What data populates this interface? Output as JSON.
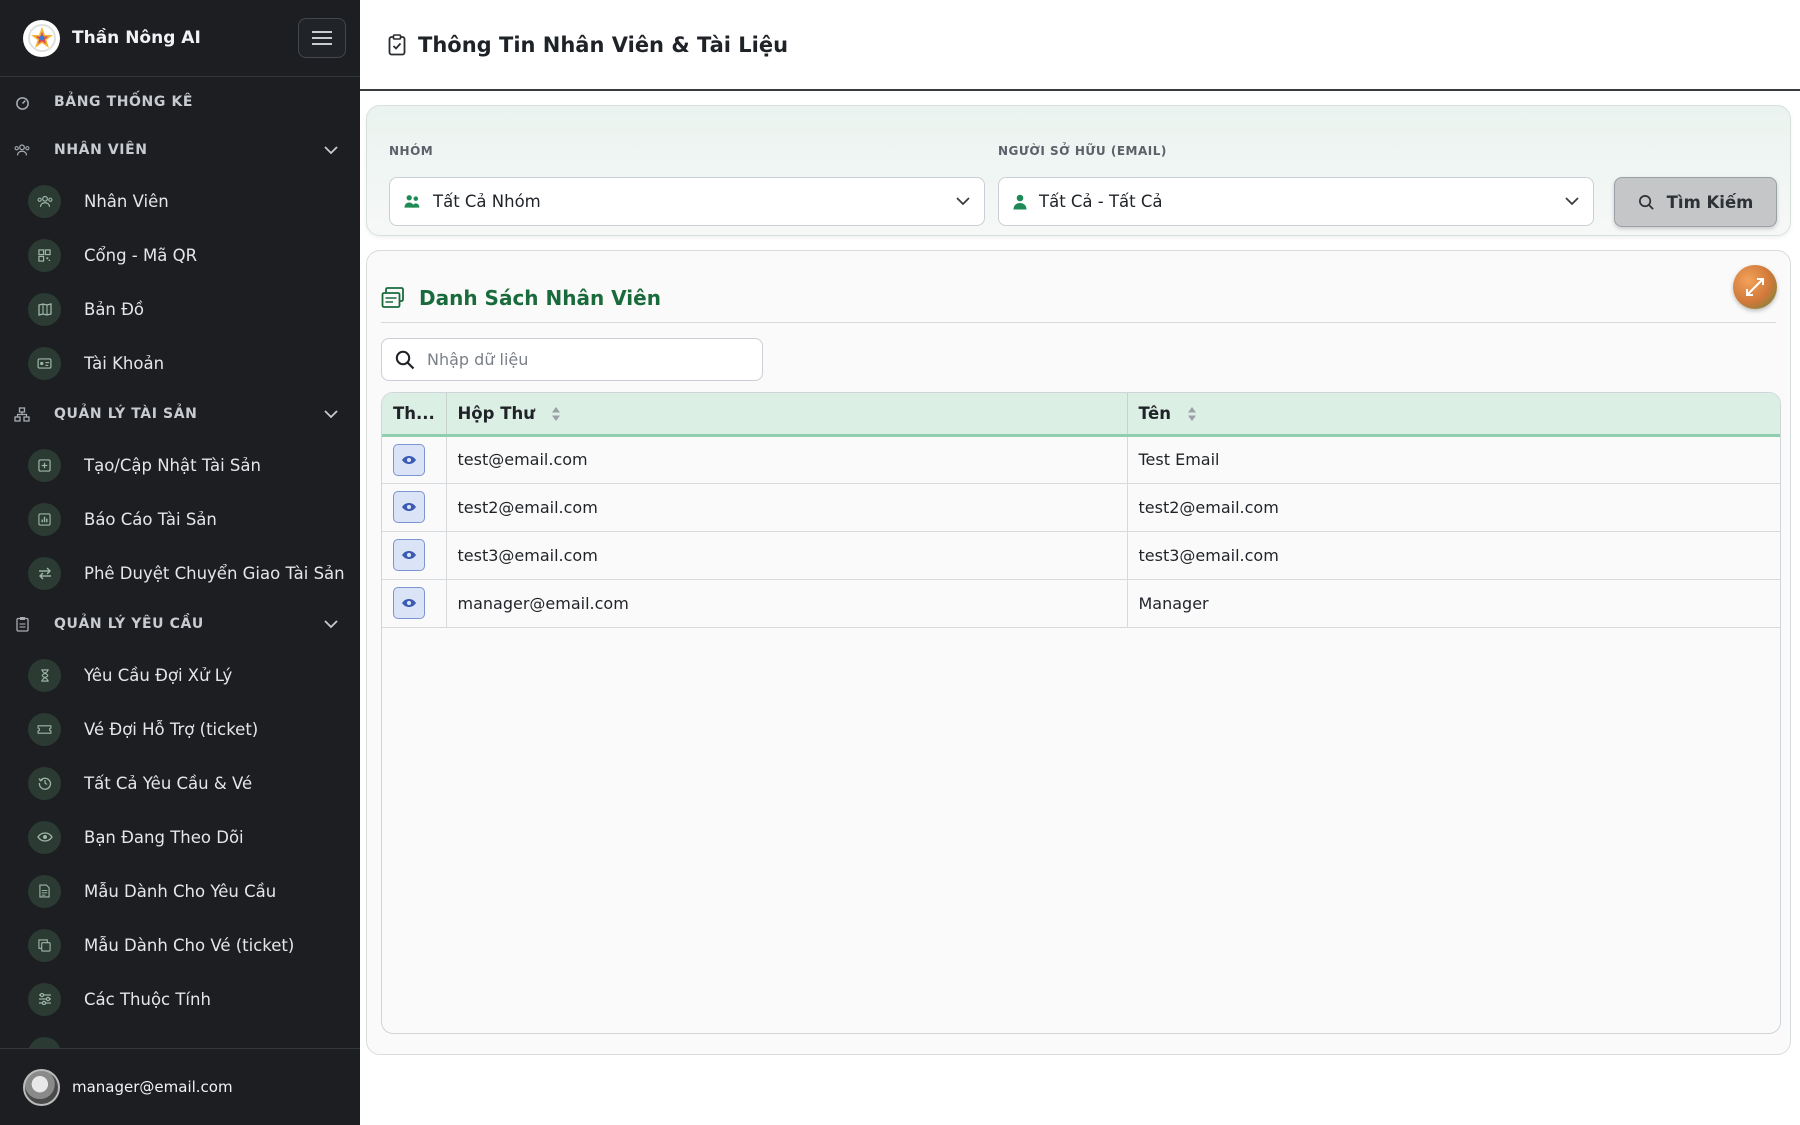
{
  "app": {
    "name": "Thần Nông AI"
  },
  "sidebar": {
    "sections": [
      {
        "label": "BẢNG THỐNG KÊ",
        "icon": "dashboard-icon",
        "collapsible": false,
        "items": []
      },
      {
        "label": "NHÂN VIÊN",
        "icon": "users-icon",
        "collapsible": true,
        "items": [
          {
            "label": "Nhân Viên",
            "icon": "users-icon"
          },
          {
            "label": "Cổng - Mã QR",
            "icon": "qr-code-icon"
          },
          {
            "label": "Bản Đồ",
            "icon": "map-icon"
          },
          {
            "label": "Tài Khoản",
            "icon": "id-card-icon"
          }
        ]
      },
      {
        "label": "QUẢN LÝ TÀI SẢN",
        "icon": "sitemap-icon",
        "collapsible": true,
        "items": [
          {
            "label": "Tạo/Cập Nhật Tài Sản",
            "icon": "plus-square-icon"
          },
          {
            "label": "Báo Cáo Tài Sản",
            "icon": "bar-chart-icon"
          },
          {
            "label": "Phê Duyệt Chuyển Giao Tài Sản",
            "icon": "transfer-icon"
          }
        ]
      },
      {
        "label": "QUẢN LÝ YÊU CẦU",
        "icon": "clipboard-icon",
        "collapsible": true,
        "items": [
          {
            "label": "Yêu Cầu Đợi Xử Lý",
            "icon": "hourglass-icon"
          },
          {
            "label": "Vé Đợi Hỗ Trợ (ticket)",
            "icon": "ticket-icon"
          },
          {
            "label": "Tất Cả Yêu Cầu & Vé",
            "icon": "history-icon"
          },
          {
            "label": "Bạn Đang Theo Dõi",
            "icon": "eye-icon"
          },
          {
            "label": "Mẫu Dành Cho Yêu Cầu",
            "icon": "document-icon"
          },
          {
            "label": "Mẫu Dành Cho Vé (ticket)",
            "icon": "copy-icon"
          },
          {
            "label": "Các Thuộc Tính",
            "icon": "sliders-icon"
          }
        ]
      }
    ],
    "footer": {
      "email": "manager@email.com"
    }
  },
  "page": {
    "title": "Thông Tin Nhân Viên & Tài Liệu"
  },
  "filters": {
    "group_label": "NHÓM",
    "group_value": "Tất Cả Nhóm",
    "owner_label": "NGƯỜI SỞ HỮU (EMAIL)",
    "owner_value": "Tất Cả - Tất Cả",
    "search_button": "Tìm Kiếm"
  },
  "employee_list": {
    "title": "Danh Sách Nhân Viên",
    "search_placeholder": "Nhập dữ liệu",
    "columns": [
      "Th...",
      "Hộp Thư",
      "Tên"
    ],
    "rows": [
      {
        "email": "test@email.com",
        "name": "Test Email"
      },
      {
        "email": "test2@email.com",
        "name": "test2@email.com"
      },
      {
        "email": "test3@email.com",
        "name": "test3@email.com"
      },
      {
        "email": "manager@email.com",
        "name": "Manager"
      }
    ]
  },
  "colors": {
    "sidebar_bg": "#1c1e21",
    "accent_green": "#1a6b3c",
    "header_row_bg": "#dcefe5",
    "view_button_bg": "#dbe4f7"
  }
}
